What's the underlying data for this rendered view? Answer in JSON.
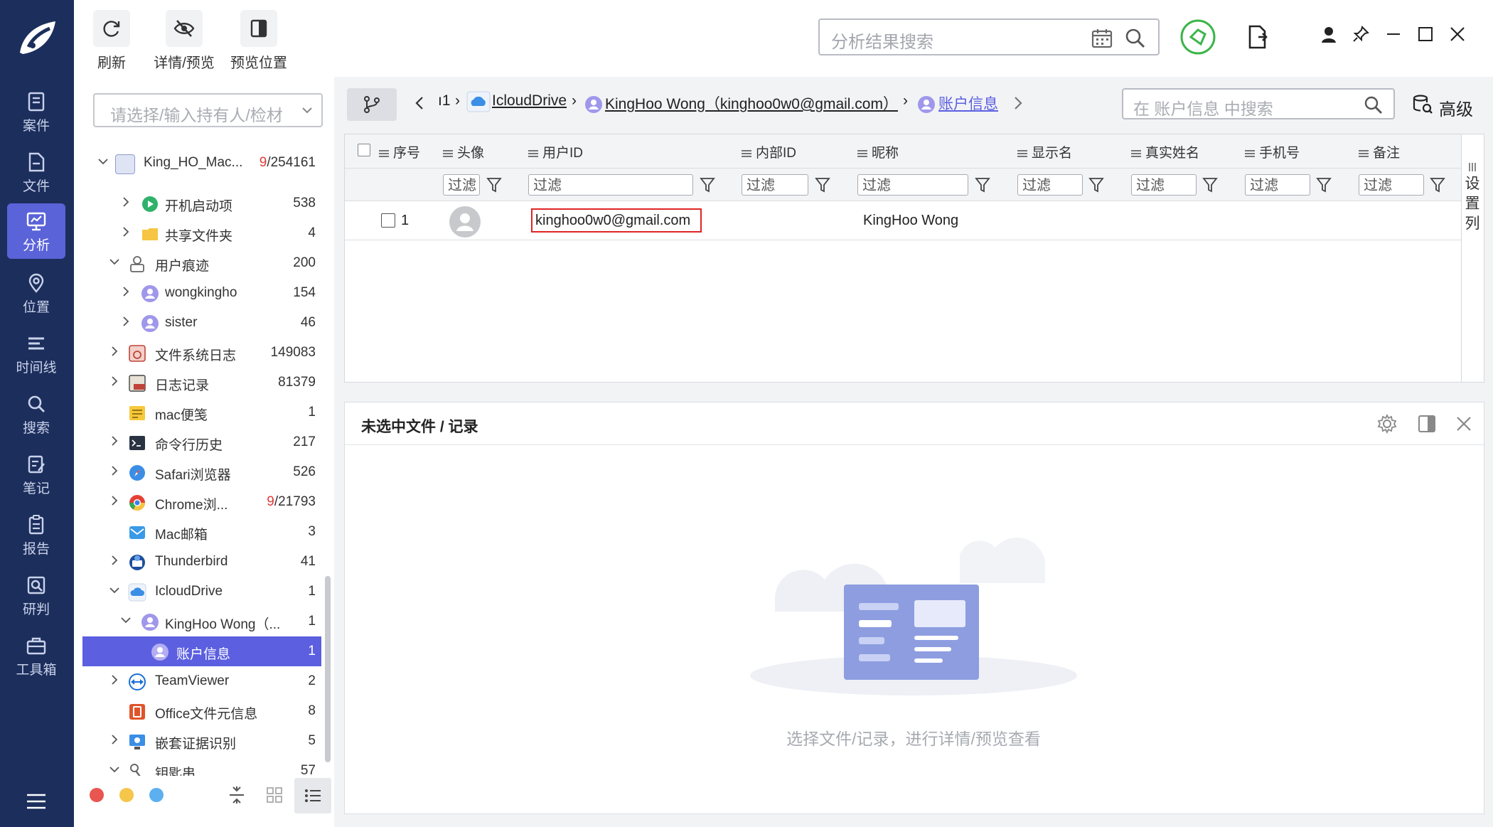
{
  "nav": {
    "items": [
      {
        "label": "案件",
        "icon": "case-icon"
      },
      {
        "label": "文件",
        "icon": "file-icon"
      },
      {
        "label": "分析",
        "icon": "analysis-icon",
        "active": true
      },
      {
        "label": "位置",
        "icon": "location-icon"
      },
      {
        "label": "时间线",
        "icon": "timeline-icon"
      },
      {
        "label": "搜索",
        "icon": "search-icon"
      },
      {
        "label": "笔记",
        "icon": "note-icon"
      },
      {
        "label": "报告",
        "icon": "report-icon"
      },
      {
        "label": "研判",
        "icon": "judge-icon"
      },
      {
        "label": "工具箱",
        "icon": "toolbox-icon"
      }
    ]
  },
  "toolbar": {
    "refresh_label": "刷新",
    "detail_preview_label": "详情/预览",
    "preview_position_label": "预览位置",
    "search_placeholder": "分析结果搜索"
  },
  "tree": {
    "owner_placeholder": "请选择/输入持有人/检材",
    "rows": [
      {
        "label": "King_HO_Mac...",
        "count_red": "9",
        "count": "/254161"
      },
      {
        "label": "开机启动项",
        "count": "538"
      },
      {
        "label": "共享文件夹",
        "count": "4"
      },
      {
        "label": "用户痕迹",
        "count": "200"
      },
      {
        "label": "wongkingho",
        "count": "154"
      },
      {
        "label": "sister",
        "count": "46"
      },
      {
        "label": "文件系统日志",
        "count": "149083"
      },
      {
        "label": "日志记录",
        "count": "81379"
      },
      {
        "label": "mac便笺",
        "count": "1"
      },
      {
        "label": "命令行历史",
        "count": "217"
      },
      {
        "label": "Safari浏览器",
        "count": "526"
      },
      {
        "label": "Chrome浏...",
        "count_red": "9",
        "count": "/21793"
      },
      {
        "label": "Mac邮箱",
        "count": "3"
      },
      {
        "label": "Thunderbird",
        "count": "41"
      },
      {
        "label": "IcloudDrive",
        "count": "1"
      },
      {
        "label": "KingHoo Wong（...",
        "count": "1"
      },
      {
        "label": "账户信息",
        "count": "1"
      },
      {
        "label": "TeamViewer",
        "count": "2"
      },
      {
        "label": "Office文件元信息",
        "count": "8"
      },
      {
        "label": "嵌套证据识别",
        "count": "5"
      },
      {
        "label": "钥匙串",
        "count": "57"
      }
    ]
  },
  "breadcrumb": {
    "partial": "ı1",
    "icloud": "IcloudDrive",
    "account": "KingHoo Wong（kinghoo0w0@gmail.com）",
    "current": "账户信息",
    "search_placeholder": "在 账户信息 中搜索",
    "advanced_label": "高级"
  },
  "table": {
    "columns": [
      "序号",
      "头像",
      "用户ID",
      "内部ID",
      "昵称",
      "显示名",
      "真实姓名",
      "手机号",
      "备注"
    ],
    "filter_placeholder": "过滤",
    "rows": [
      {
        "index": "1",
        "user_id": "kinghoo0w0@gmail.com",
        "nickname": "KingHoo Wong"
      }
    ],
    "side_tab_label": "设置列"
  },
  "preview": {
    "title": "未选中文件 / 记录",
    "empty_text": "选择文件/记录，进行详情/预览查看"
  },
  "colors": {
    "nav_bg": "#1c2e5c",
    "accent": "#5b5fe0",
    "badge_red": "#e03a3a"
  }
}
